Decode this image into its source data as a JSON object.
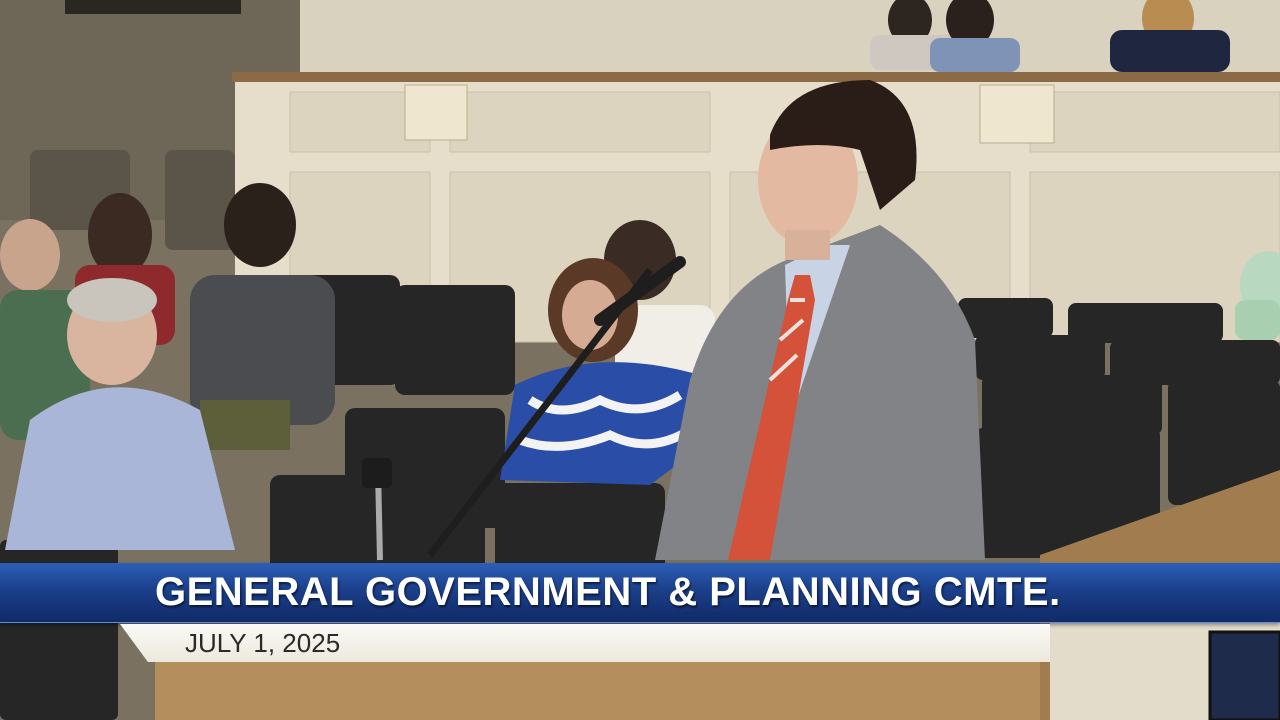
{
  "overlay": {
    "title": "GENERAL GOVERNMENT & PLANNING CMTE.",
    "date": "JULY 1, 2025"
  },
  "colors": {
    "title_bar": "#1b3f8a",
    "title_text": "#ffffff",
    "date_bar": "#f3f0e8",
    "date_text": "#2a2a2a"
  }
}
